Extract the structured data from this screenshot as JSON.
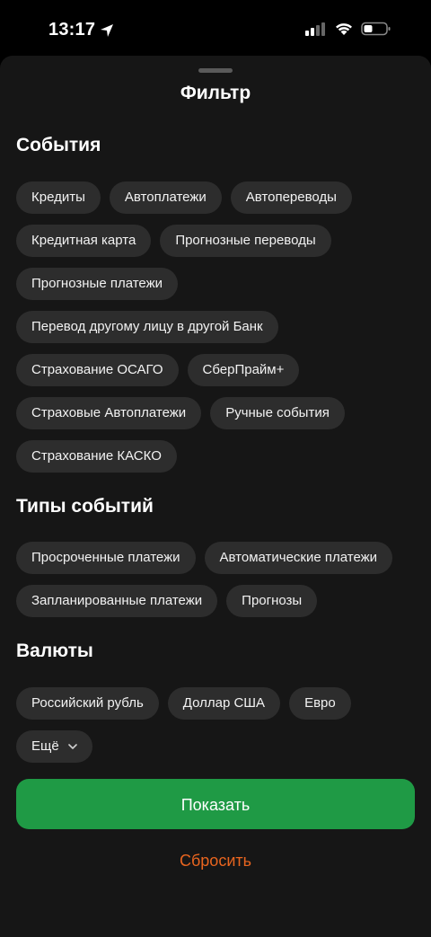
{
  "status_bar": {
    "time": "13:17"
  },
  "sheet": {
    "title": "Фильтр"
  },
  "sections": {
    "events": {
      "title": "События",
      "chips": [
        "Кредиты",
        "Автоплатежи",
        "Автопереводы",
        "Кредитная карта",
        "Прогнозные переводы",
        "Прогнозные платежи",
        "Перевод другому лицу в другой Банк",
        "Страхование ОСАГО",
        "СберПрайм+",
        "Страховые Автоплатежи",
        "Ручные события",
        "Страхование КАСКО"
      ]
    },
    "event_types": {
      "title": "Типы событий",
      "chips": [
        "Просроченные платежи",
        "Автоматические платежи",
        "Запланированные платежи",
        "Прогнозы"
      ]
    },
    "currencies": {
      "title": "Валюты",
      "chips": [
        "Российский рубль",
        "Доллар США",
        "Евро"
      ],
      "more_label": "Ещё"
    }
  },
  "actions": {
    "show_label": "Показать",
    "reset_label": "Сбросить"
  },
  "colors": {
    "accent_green": "#1f9a45",
    "reset_orange": "#e9651f",
    "chip_bg": "#2d2d2d",
    "sheet_bg": "#161616"
  }
}
